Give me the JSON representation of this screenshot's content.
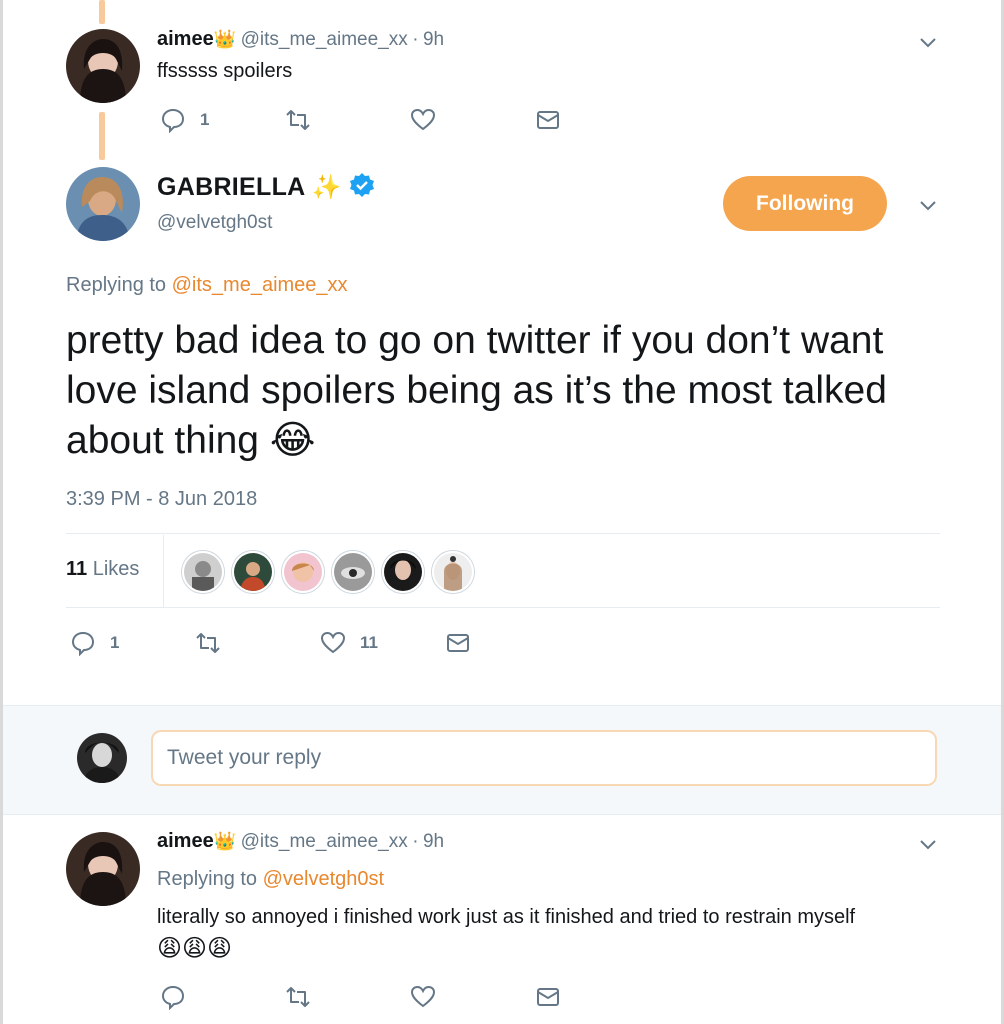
{
  "tweet1": {
    "name": "aimee",
    "crown": "👑",
    "handle": "@its_me_aimee_xx",
    "dot": "·",
    "time": "9h",
    "text": "ffsssss spoilers",
    "reply_count": "1",
    "like_count": ""
  },
  "main_tweet": {
    "name": "GABRIELLA",
    "sparkles": "✨",
    "handle": "@velvetgh0st",
    "follow_label": "Following",
    "replying_prefix": "Replying to",
    "replying_to": "@its_me_aimee_xx",
    "text": "pretty bad idea to go on twitter if you don’t want love island spoilers being as it’s the most talked about thing",
    "emoji": "😂",
    "timestamp": "3:39 PM - 8 Jun 2018",
    "likes_count": "11",
    "likes_label": "Likes",
    "reply_count": "1",
    "like_count": "11"
  },
  "reply_box": {
    "placeholder": "Tweet your reply"
  },
  "tweet3": {
    "name": "aimee",
    "crown": "👑",
    "handle": "@its_me_aimee_xx",
    "dot": "·",
    "time": "9h",
    "replying_prefix": "Replying to",
    "replying_to": "@velvetgh0st",
    "text": "literally so annoyed i finished work just as it finished and tried to restrain myself",
    "emojis": "😩😩😩"
  },
  "colors": {
    "accent": "#f4a54e",
    "link": "#e8882f",
    "verified": "#1da1f2",
    "muted": "#657786"
  },
  "icons": [
    "reply-icon",
    "retweet-icon",
    "like-icon",
    "message-icon",
    "chevron-down-icon",
    "verified-icon"
  ]
}
